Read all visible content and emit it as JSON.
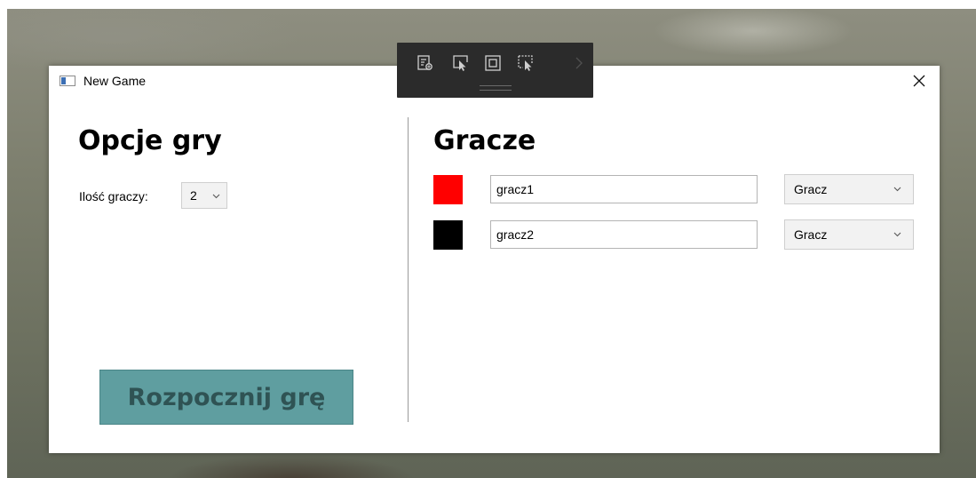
{
  "window": {
    "title": "New Game",
    "icons": {
      "app": "app-window-icon",
      "close": "close-icon"
    }
  },
  "debug_toolbar": {
    "icons": [
      "live-visual-tree-icon",
      "select-element-icon",
      "display-layout-adorners-icon",
      "track-focus-icon",
      "chevron-right-icon"
    ]
  },
  "options": {
    "title": "Opcje gry",
    "player_count_label": "Ilość graczy:",
    "player_count_value": "2",
    "start_button_label": "Rozpocznij grę"
  },
  "players": {
    "title": "Gracze",
    "rows": [
      {
        "color": "#ff0000",
        "name": "gracz1",
        "type": "Gracz"
      },
      {
        "color": "#000000",
        "name": "gracz2",
        "type": "Gracz"
      }
    ]
  },
  "colors": {
    "start_button_bg": "#5f9ea0",
    "start_button_text": "#2f5354",
    "toolbar_bg": "#2b2b2b"
  }
}
